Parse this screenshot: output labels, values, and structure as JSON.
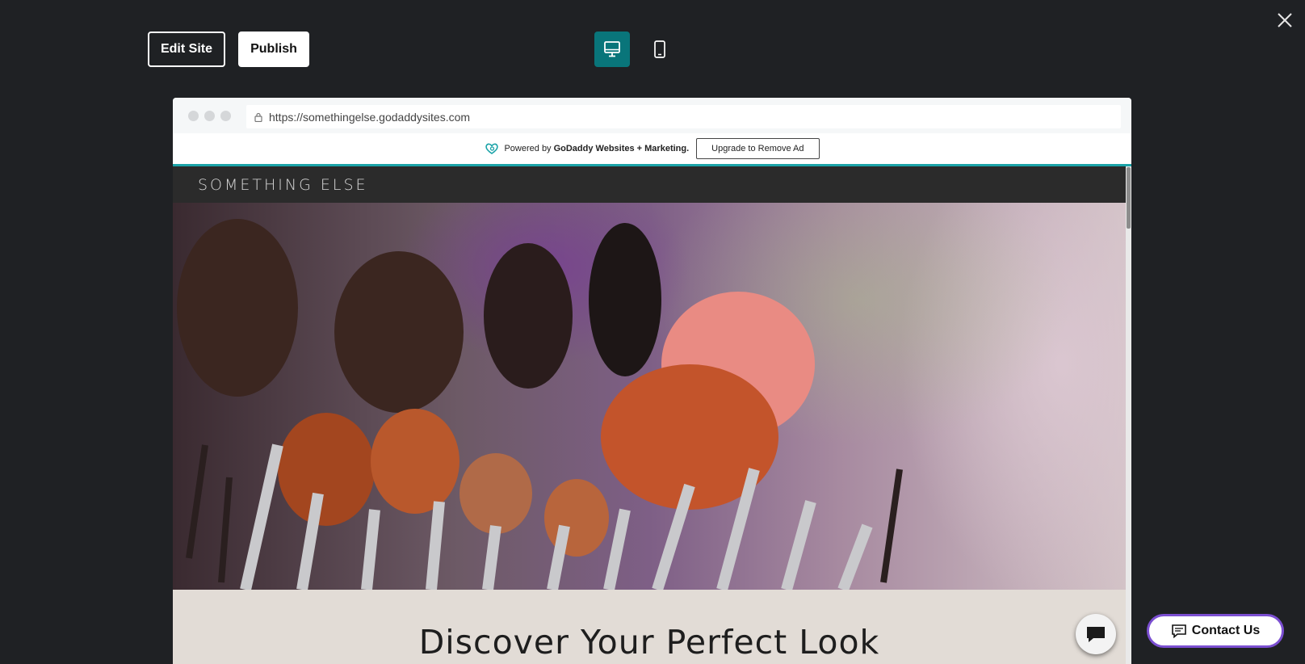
{
  "toolbar": {
    "edit_label": "Edit Site",
    "publish_label": "Publish"
  },
  "devices": {
    "desktop_icon": "desktop-monitor-icon",
    "mobile_icon": "mobile-phone-icon",
    "active": "desktop",
    "active_color": "#09757a"
  },
  "close_icon": "close-icon",
  "browser": {
    "url": "https://somethingelse.godaddysites.com"
  },
  "ad": {
    "powered_by": "Powered by",
    "brand": "GoDaddy Websites + Marketing.",
    "upgrade_label": "Upgrade to Remove Ad",
    "accent_color": "#1ba3a8"
  },
  "site": {
    "title": "SOMETHING ELSE",
    "tagline": "Discover Your Perfect Look"
  },
  "contact": {
    "label": "Contact Us",
    "border_color": "#7b4fd1"
  }
}
